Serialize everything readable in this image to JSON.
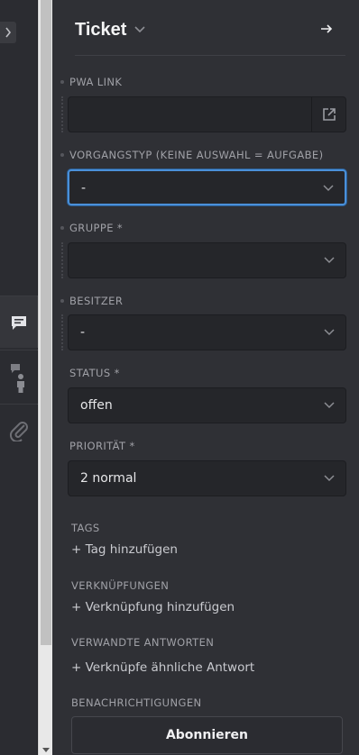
{
  "header": {
    "title": "Ticket"
  },
  "fields": {
    "pwa_link": {
      "label": "PWA LINK",
      "value": ""
    },
    "vorgangstyp": {
      "label": "VORGANGSTYP (KEINE AUSWAHL = AUFGABE)",
      "value": "-"
    },
    "gruppe": {
      "label": "GRUPPE *",
      "value": ""
    },
    "besitzer": {
      "label": "BESITZER",
      "value": "-"
    },
    "status": {
      "label": "STATUS *",
      "value": "offen"
    },
    "prioritaet": {
      "label": "PRIORITÄT *",
      "value": "2 normal"
    }
  },
  "sections": {
    "tags": {
      "label": "TAGS",
      "action": "+ Tag hinzufügen"
    },
    "verknuepfungen": {
      "label": "VERKNÜPFUNGEN",
      "action": "+ Verknüpfung hinzufügen"
    },
    "verwandte": {
      "label": "VERWANDTE ANTWORTEN",
      "action": "+ Verknüpfe ähnliche Antwort"
    },
    "benachrichtigungen": {
      "label": "BENACHRICHTIGUNGEN",
      "button": "Abonnieren"
    }
  },
  "icons": {
    "expand": "chevron-right-icon",
    "title_chevron": "chevron-down-icon",
    "close": "arrow-right-icon",
    "external_link": "external-link-icon",
    "select_chevron": "chevron-down-icon",
    "sidebar_chat": "chat-bubble-icon",
    "sidebar_customer": "customer-icon",
    "sidebar_attachment": "paperclip-icon"
  },
  "colors": {
    "focus_border": "#4a90d9",
    "background": "#2f3035",
    "field_bg": "#25262a"
  }
}
